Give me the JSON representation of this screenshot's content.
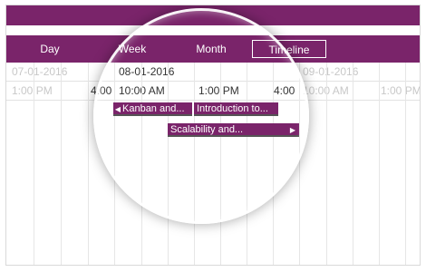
{
  "views": {
    "day": "Day",
    "week": "Week",
    "month": "Month",
    "timeline": "Timeline"
  },
  "dates": {
    "d1": "07-01-2016",
    "d2": "08-01-2016",
    "d3": "09-01-2016"
  },
  "times": {
    "t1": "1:00 PM",
    "t2": "4:00",
    "t3": "10:00 AM",
    "t4": "1:00 PM",
    "t5": "4:00",
    "t6": "10:00 AM",
    "t7": "1:00 PM"
  },
  "events": {
    "kanban": "Kanban and...",
    "intro": "Introduction to...",
    "scalability": "Scalability and..."
  },
  "colors": {
    "accent": "#7a246a"
  }
}
